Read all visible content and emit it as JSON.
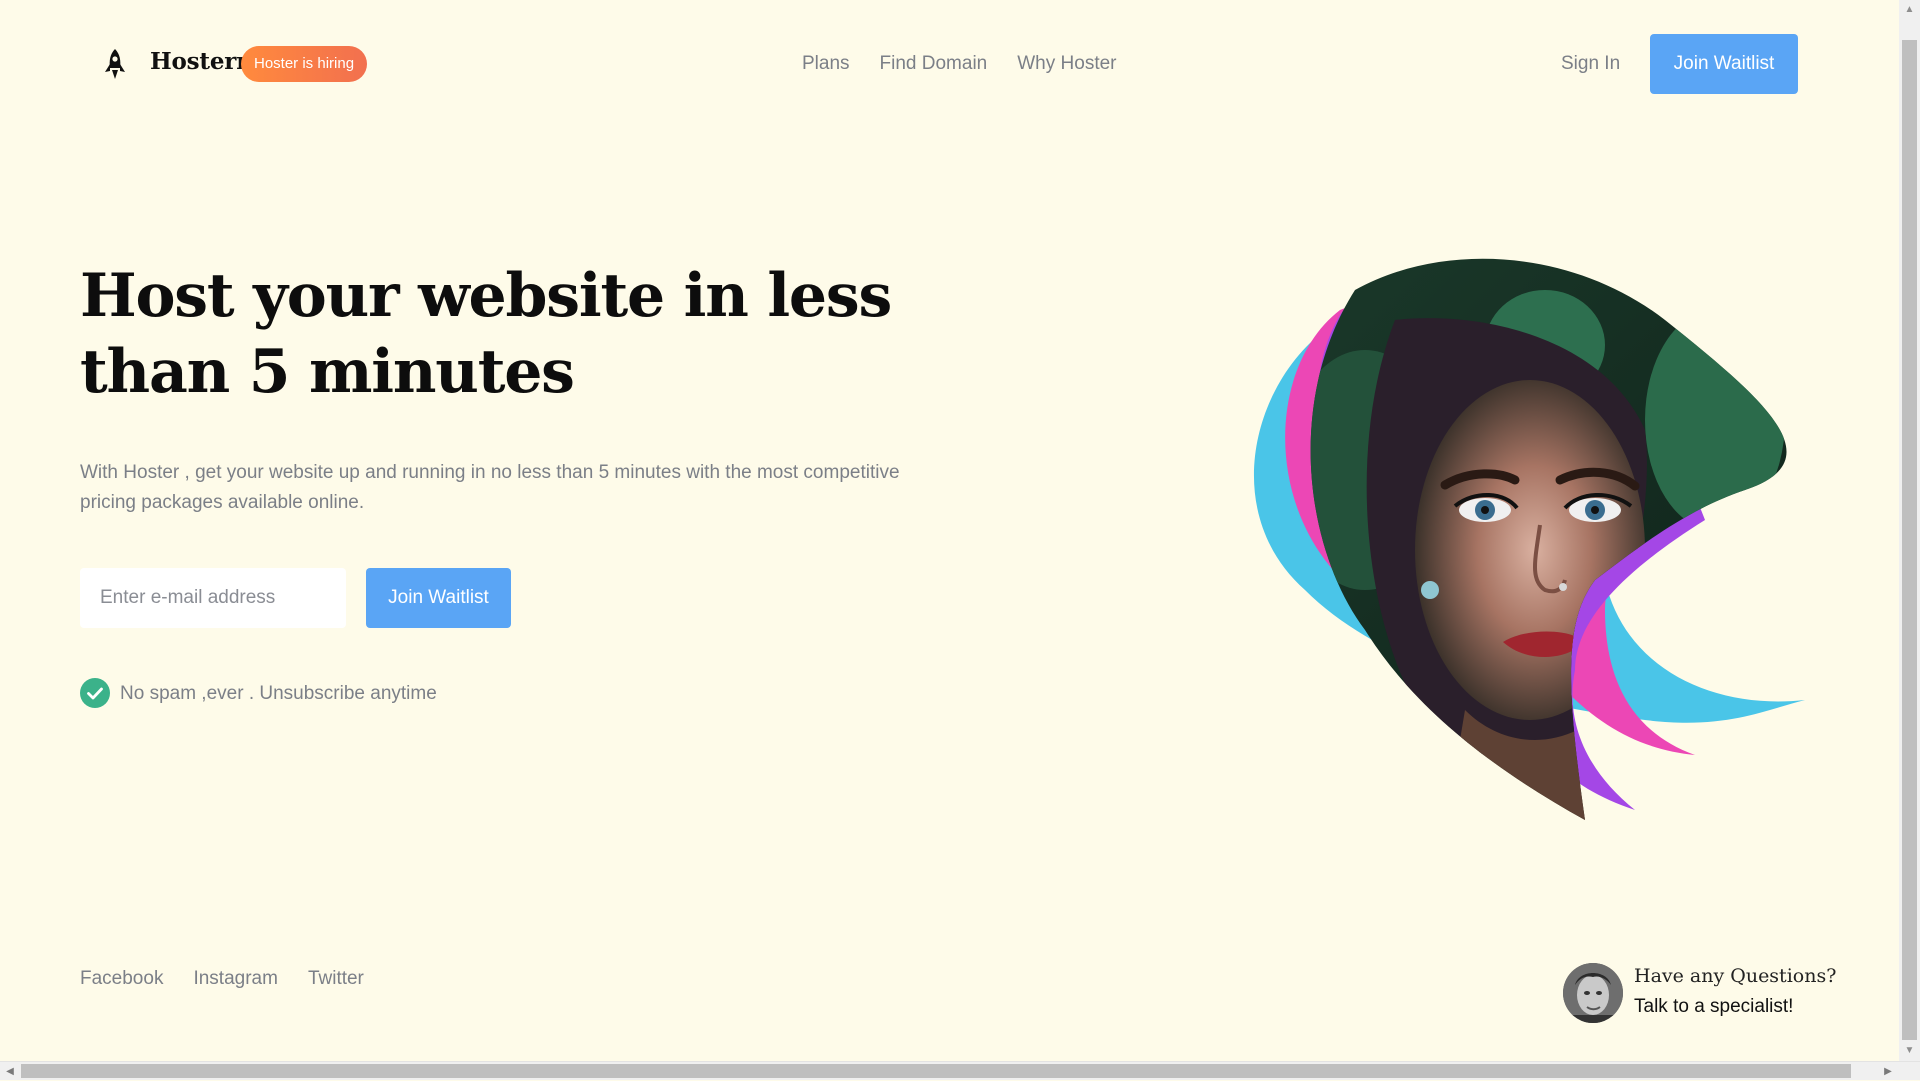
{
  "header": {
    "brand": "Hosterr",
    "hiring_badge": "Hoster is hiring",
    "nav": [
      "Plans",
      "Find Domain",
      "Why Hoster"
    ],
    "sign_in": "Sign In",
    "cta": "Join Waitlist"
  },
  "hero": {
    "title": "Host your website in less than 5 minutes",
    "description": "With Hoster , get your website up and running in no less than 5 minutes with the most competitive pricing packages available online.",
    "email_placeholder": "Enter e-mail address",
    "cta": "Join Waitlist",
    "no_spam": "No spam ,ever . Unsubscribe anytime"
  },
  "footer": {
    "social": [
      "Facebook",
      "Instagram",
      "Twitter"
    ],
    "question": "Have any Questions?",
    "specialist": "Talk to a specialist!"
  },
  "colors": {
    "background": "#fefbe9",
    "accent": "#5aa5f5",
    "badge_start": "#ff8a3d",
    "badge_end": "#f2704f",
    "muted_text": "#7b7f87",
    "check": "#3bb28a",
    "art_blue": "#4ac5e8",
    "art_pink": "#ec47b5",
    "art_purple": "#a447e6"
  },
  "icons": {
    "logo": "rocket-icon",
    "check": "check-circle-icon"
  }
}
